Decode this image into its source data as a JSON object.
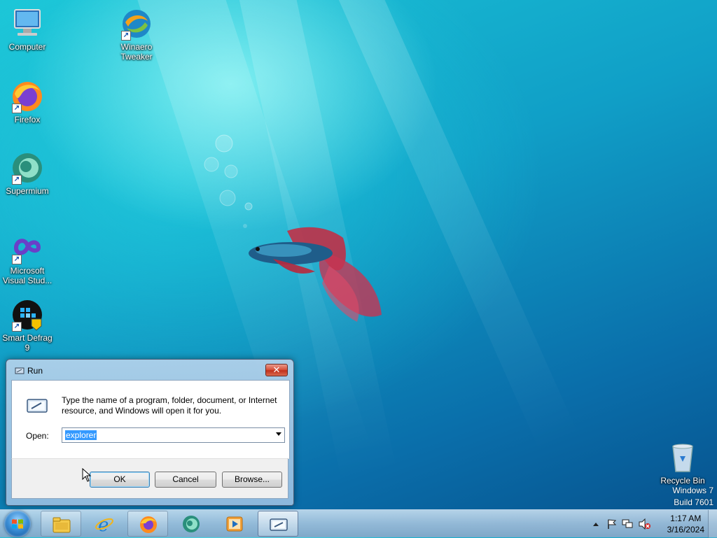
{
  "desktop": {
    "icons": [
      {
        "label": "Computer",
        "icon": "computer-icon"
      },
      {
        "label": "Winaero Tweaker",
        "icon": "winaero-tweaker-icon"
      },
      {
        "label": "Firefox",
        "icon": "firefox-icon"
      },
      {
        "label": "Supermium",
        "icon": "supermium-icon"
      },
      {
        "label": "Microsoft Visual Stud...",
        "icon": "visual-studio-icon"
      },
      {
        "label": "Smart Defrag 9",
        "icon": "smart-defrag-icon"
      },
      {
        "label": "Recycle Bin",
        "icon": "recycle-bin-icon"
      }
    ],
    "watermark": {
      "line1": "Windows 7",
      "line2": "Build 7601"
    }
  },
  "run_dialog": {
    "title": "Run",
    "close_label": "✕",
    "description": "Type the name of a program, folder, document, or Internet resource, and Windows will open it for you.",
    "open_label": "Open:",
    "open_value": "explorer",
    "ok_label": "OK",
    "cancel_label": "Cancel",
    "browse_label": "Browse..."
  },
  "taskbar": {
    "start_icon": "windows-start-orb-icon",
    "items": [
      {
        "name": "file-explorer",
        "icon": "folder-icon",
        "state": "pinned"
      },
      {
        "name": "internet-explorer",
        "icon": "internet-explorer-icon",
        "state": "pinned"
      },
      {
        "name": "firefox",
        "icon": "firefox-icon",
        "state": "running"
      },
      {
        "name": "supermium",
        "icon": "supermium-icon",
        "state": "pinned"
      },
      {
        "name": "media-player",
        "icon": "media-player-icon",
        "state": "pinned"
      },
      {
        "name": "run",
        "icon": "run-icon",
        "state": "active"
      }
    ],
    "tray": {
      "time": "1:17 AM",
      "date": "3/16/2024"
    }
  },
  "colors": {
    "accent": "#3399ff",
    "close_button": "#c1321c"
  }
}
